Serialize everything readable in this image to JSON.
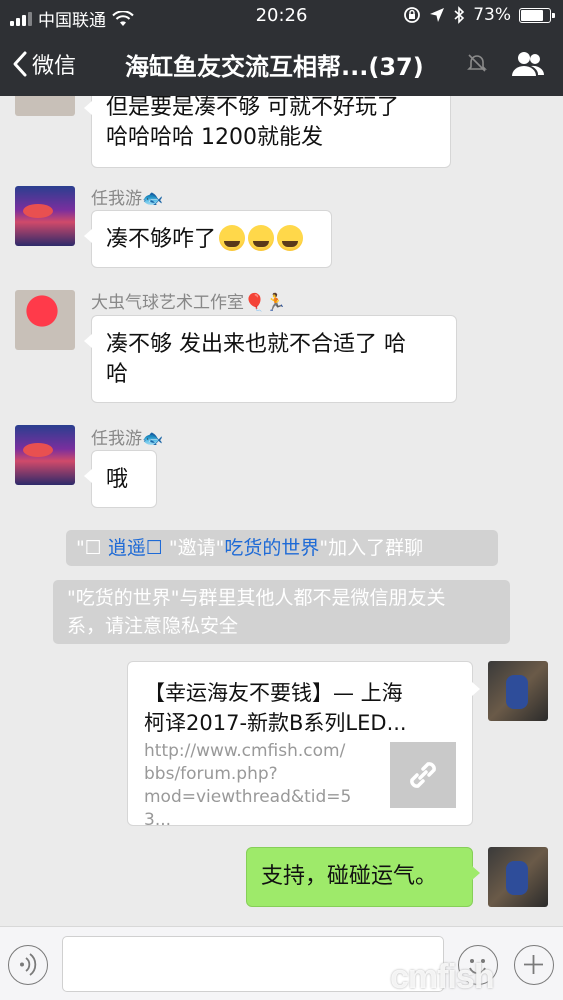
{
  "status_bar": {
    "carrier": "中国联通",
    "time": "20:26",
    "battery": "73%",
    "battery_level": 0.73
  },
  "nav": {
    "back_label": "微信",
    "title": "海缸鱼友交流互相帮...(37)"
  },
  "messages": [
    {
      "text_line1": "但是要是凑不够 可就不好玩了",
      "text_line2": "哈哈哈哈   1200就能发"
    },
    {
      "nick": "任我游🐟",
      "text": "凑不够咋了"
    },
    {
      "nick": "大虫气球艺术工作室🎈🏃",
      "text_line1": "凑不够  发出来也就不合适了 哈",
      "text_line2": "哈"
    },
    {
      "nick": "任我游🐟",
      "text": "哦"
    }
  ],
  "system_messages": {
    "invite_pre": "\"☐  ",
    "inviter": "逍遥☐",
    "invite_mid": " \"邀请\"",
    "invitee": "吃货的世界",
    "invite_post": "\"加入了群聊",
    "privacy_line1": "\"吃货的世界\"与群里其他人都不是微信朋友关",
    "privacy_line2": "系，请注意隐私安全"
  },
  "share_card": {
    "title_line1": "【幸运海友不要钱】— 上海",
    "title_line2": "柯译2017-新款B系列LED...",
    "url_line1": "http://www.cmfish.com/",
    "url_line2": "bbs/forum.php?",
    "url_line3": "mod=viewthread&tid=53..."
  },
  "my_message": {
    "text": "支持，碰碰运气。"
  },
  "watermark": "cmfish",
  "icons": [
    "wifi-icon",
    "lock-rotation-icon",
    "location-icon",
    "bluetooth-icon",
    "chevron-left-icon",
    "mute-bell-icon",
    "group-members-icon",
    "link-icon",
    "voice-icon",
    "emoji-icon",
    "plus-icon"
  ]
}
